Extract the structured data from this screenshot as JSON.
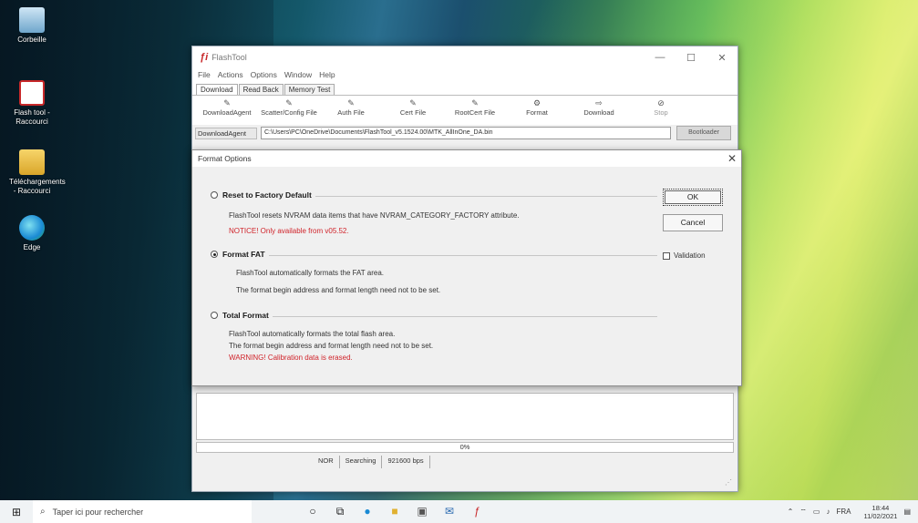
{
  "desktop": {
    "icons": [
      {
        "label": "Corbeille",
        "icon": "recycle-bin-icon"
      },
      {
        "label": "Flash tool - Raccourci",
        "icon": "flashtool-shortcut-icon"
      },
      {
        "label": "Téléchargements - Raccourci",
        "icon": "folder-icon"
      },
      {
        "label": "Edge",
        "icon": "edge-icon"
      }
    ]
  },
  "window": {
    "title": "FlashTool",
    "controls": {
      "minimize": "—",
      "maximize": "☐",
      "close": "✕"
    },
    "menu": [
      "File",
      "Actions",
      "Options",
      "Window",
      "Help"
    ],
    "tabs": [
      "Download",
      "Read Back",
      "Memory Test"
    ],
    "toolbar": [
      {
        "label": "DownloadAgent",
        "icon": "download-agent-icon",
        "glyph": "✎"
      },
      {
        "label": "Scatter/Config File",
        "icon": "scatter-file-icon",
        "glyph": "✎"
      },
      {
        "label": "Auth File",
        "icon": "auth-file-icon",
        "glyph": "✎"
      },
      {
        "label": "Cert File",
        "icon": "cert-file-icon",
        "glyph": "✎"
      },
      {
        "label": "RootCert File",
        "icon": "rootcert-file-icon",
        "glyph": "✎"
      },
      {
        "label": "Format",
        "icon": "format-icon",
        "glyph": "⚙"
      },
      {
        "label": "Download",
        "icon": "download-icon",
        "glyph": "⇨"
      },
      {
        "label": "Stop",
        "icon": "stop-icon",
        "glyph": "⊘"
      }
    ],
    "agent": {
      "label": "DownloadAgent",
      "path": "C:\\Users\\PC\\OneDrive\\Documents\\FlashTool_v5.1524.00\\MTK_AllInOne_DA.bin",
      "bootloader_label": "Bootloader"
    },
    "progress_text": "0%",
    "status": {
      "mode": "NOR",
      "state": "Searching",
      "baud": "921600 bps"
    }
  },
  "dialog": {
    "title": "Format Options",
    "close": "✕",
    "options": [
      {
        "label": "Reset to Factory Default",
        "selected": false,
        "lines": [
          {
            "text": "FlashTool resets NVRAM data items that have NVRAM_CATEGORY_FACTORY attribute.",
            "warn": false
          },
          {
            "text": "NOTICE! Only available from v05.52.",
            "warn": true
          }
        ]
      },
      {
        "label": "Format FAT",
        "selected": true,
        "lines": [
          {
            "text": "FlashTool automatically formats the FAT area.",
            "warn": false
          },
          {
            "text": "The format begin address and format length need not to be set.",
            "warn": false
          }
        ]
      },
      {
        "label": "Total Format",
        "selected": false,
        "lines": [
          {
            "text": "FlashTool automatically formats the total flash area.",
            "warn": false
          },
          {
            "text": "The format begin address and format length need not to be set.",
            "warn": false
          },
          {
            "text": "WARNING! Calibration data is erased.",
            "warn": true
          }
        ]
      }
    ],
    "ok_label": "OK",
    "cancel_label": "Cancel",
    "validation_label": "Validation"
  },
  "taskbar": {
    "search_placeholder": "Taper ici pour rechercher",
    "tray_lang": "FRA",
    "time": "18:44",
    "date": "11/02/2021"
  },
  "colors": {
    "warning": "#d0232a",
    "accent": "#0078d7"
  }
}
